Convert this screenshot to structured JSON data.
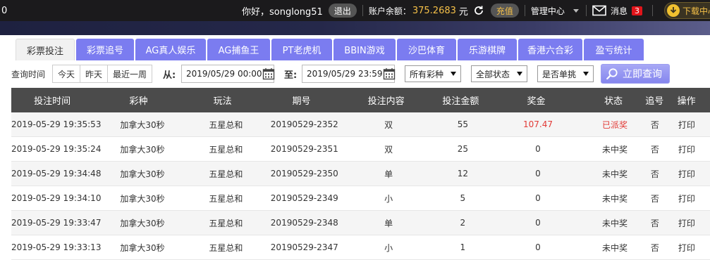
{
  "topbar": {
    "left_fragment": "0",
    "greeting": "你好，songlong51",
    "logout": "退出",
    "balance_label": "账户余额：",
    "balance_value": "375.2683",
    "balance_unit": "元",
    "recharge": "充值",
    "management": "管理中心",
    "messages": "消息",
    "message_count": "3",
    "download": "下载中心"
  },
  "tabs": [
    {
      "label": "彩票投注",
      "active": true
    },
    {
      "label": "彩票追号"
    },
    {
      "label": "AG真人娱乐"
    },
    {
      "label": "AG捕鱼王"
    },
    {
      "label": "PT老虎机"
    },
    {
      "label": "BBIN游戏"
    },
    {
      "label": "沙巴体育"
    },
    {
      "label": "乐游棋牌"
    },
    {
      "label": "香港六合彩"
    },
    {
      "label": "盈亏统计"
    }
  ],
  "filters": {
    "query_time_label": "查询时间",
    "quick": [
      "今天",
      "昨天",
      "最近一周"
    ],
    "from_label": "从:",
    "from_value": "2019/05/29 00:00",
    "to_label": "至:",
    "to_value": "2019/05/29 23:59",
    "lottery_select": "所有彩种",
    "status_select": "全部状态",
    "single_select": "是否单挑",
    "query_button": "立即查询"
  },
  "table": {
    "columns": [
      "投注时间",
      "彩种",
      "玩法",
      "期号",
      "投注内容",
      "投注金额",
      "奖金",
      "状态",
      "追号",
      "操作"
    ],
    "rows": [
      [
        "2019-05-29 19:35:53",
        "加拿大30秒",
        "五星总和",
        "20190529-2352",
        "双",
        "55",
        "107.47",
        "已派奖",
        "否",
        "打印"
      ],
      [
        "2019-05-29 19:35:24",
        "加拿大30秒",
        "五星总和",
        "20190529-2351",
        "双",
        "25",
        "0",
        "未中奖",
        "否",
        "打印"
      ],
      [
        "2019-05-29 19:34:48",
        "加拿大30秒",
        "五星总和",
        "20190529-2350",
        "单",
        "12",
        "0",
        "未中奖",
        "否",
        "打印"
      ],
      [
        "2019-05-29 19:34:10",
        "加拿大30秒",
        "五星总和",
        "20190529-2349",
        "小",
        "5",
        "0",
        "未中奖",
        "否",
        "打印"
      ],
      [
        "2019-05-29 19:33:47",
        "加拿大30秒",
        "五星总和",
        "20190529-2348",
        "单",
        "2",
        "0",
        "未中奖",
        "否",
        "打印"
      ],
      [
        "2019-05-29 19:33:13",
        "加拿大30秒",
        "五星总和",
        "20190529-2347",
        "小",
        "1",
        "0",
        "未中奖",
        "否",
        "打印"
      ]
    ]
  },
  "colors": {
    "accent": "#7b7cf0",
    "win": "#e23a36",
    "balance": "#f5c048"
  }
}
